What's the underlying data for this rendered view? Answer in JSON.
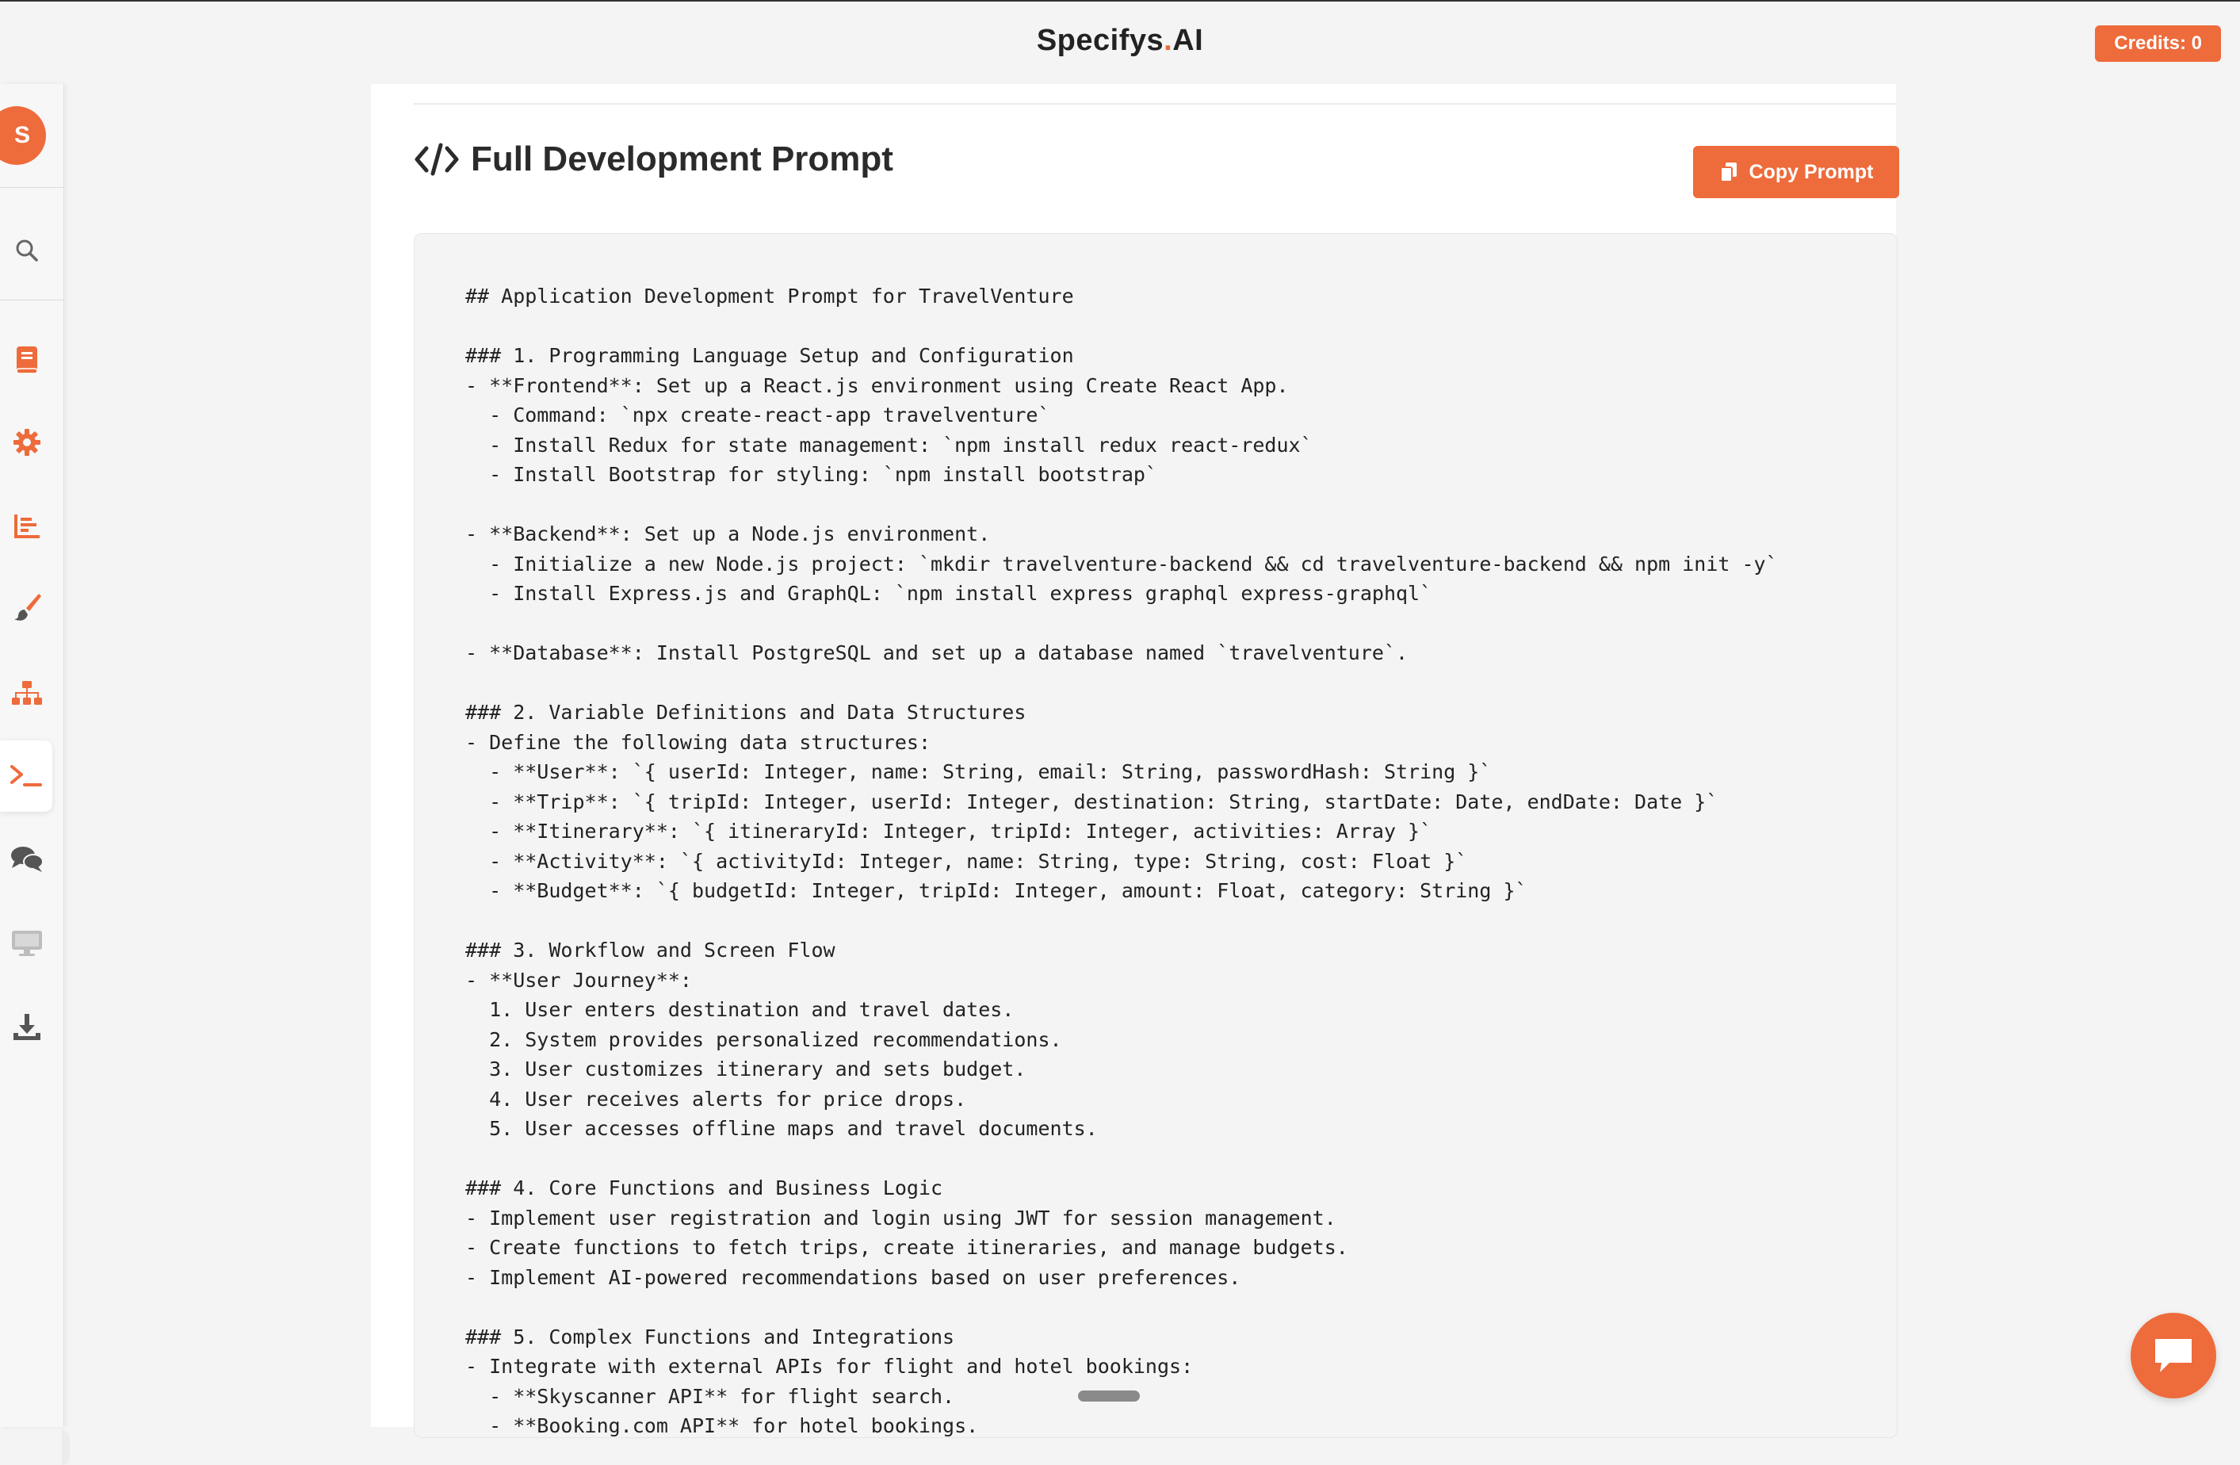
{
  "header": {
    "brand_left": "Specifys",
    "brand_dot": ".",
    "brand_right": "AI",
    "credits_label": "Credits: 0"
  },
  "colors": {
    "accent": "#ee6b3b",
    "text": "#2b2b2b",
    "code_bg": "#f4f4f4"
  },
  "sidebar": {
    "avatar_initial": "S",
    "items": [
      {
        "icon": "search-icon"
      },
      {
        "icon": "book-icon"
      },
      {
        "icon": "gear-icon"
      },
      {
        "icon": "bar-chart-icon"
      },
      {
        "icon": "paint-brush-icon"
      },
      {
        "icon": "sitemap-icon"
      },
      {
        "icon": "terminal-icon",
        "active": true
      },
      {
        "icon": "chat-bubbles-icon"
      },
      {
        "icon": "monitor-icon"
      },
      {
        "icon": "download-icon"
      }
    ]
  },
  "main": {
    "title": "Full Development Prompt",
    "copy_button_label": "Copy Prompt",
    "prompt_lines": [
      "## Application Development Prompt for TravelVenture",
      "",
      "### 1. Programming Language Setup and Configuration",
      "- **Frontend**: Set up a React.js environment using Create React App.",
      "  - Command: `npx create-react-app travelventure`",
      "  - Install Redux for state management: `npm install redux react-redux`",
      "  - Install Bootstrap for styling: `npm install bootstrap`",
      "",
      "- **Backend**: Set up a Node.js environment.",
      "  - Initialize a new Node.js project: `mkdir travelventure-backend && cd travelventure-backend && npm init -y`",
      "  - Install Express.js and GraphQL: `npm install express graphql express-graphql`",
      "",
      "- **Database**: Install PostgreSQL and set up a database named `travelventure`.",
      "",
      "### 2. Variable Definitions and Data Structures",
      "- Define the following data structures:",
      "  - **User**: `{ userId: Integer, name: String, email: String, passwordHash: String }`",
      "  - **Trip**: `{ tripId: Integer, userId: Integer, destination: String, startDate: Date, endDate: Date }`",
      "  - **Itinerary**: `{ itineraryId: Integer, tripId: Integer, activities: Array }`",
      "  - **Activity**: `{ activityId: Integer, name: String, type: String, cost: Float }`",
      "  - **Budget**: `{ budgetId: Integer, tripId: Integer, amount: Float, category: String }`",
      "",
      "### 3. Workflow and Screen Flow",
      "- **User Journey**:",
      "  1. User enters destination and travel dates.",
      "  2. System provides personalized recommendations.",
      "  3. User customizes itinerary and sets budget.",
      "  4. User receives alerts for price drops.",
      "  5. User accesses offline maps and travel documents.",
      "",
      "### 4. Core Functions and Business Logic",
      "- Implement user registration and login using JWT for session management.",
      "- Create functions to fetch trips, create itineraries, and manage budgets.",
      "- Implement AI-powered recommendations based on user preferences.",
      "",
      "### 5. Complex Functions and Integrations",
      "- Integrate with external APIs for flight and hotel bookings:",
      "  - **Skyscanner API** for flight search.",
      "  - **Booking.com API** for hotel bookings."
    ]
  },
  "chat": {
    "icon": "chat-icon"
  }
}
